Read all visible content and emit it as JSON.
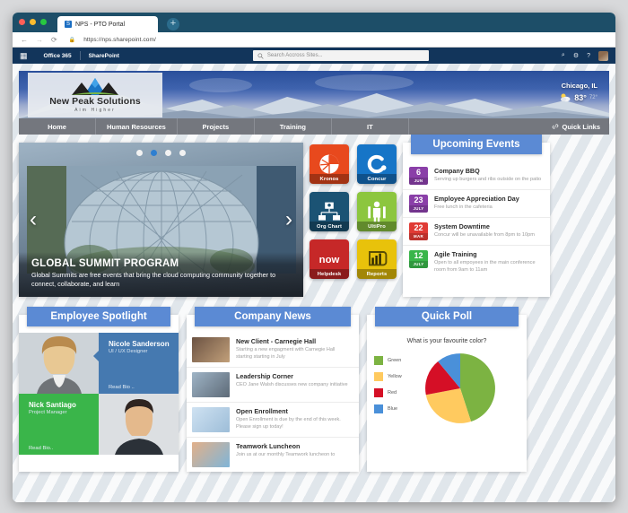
{
  "browser": {
    "tab_title": "NPS - PTO Portal",
    "tab_favicon": "sharepoint-favicon",
    "new_tab_label": "+",
    "back_icon": "←",
    "forward_icon": "→",
    "reload_icon": "⟳",
    "lock_icon": "●",
    "url": "https://nps.sharepoint.com/"
  },
  "suitebar": {
    "waffle_icon": "app-launcher-icon",
    "brand": "Office 365",
    "app": "SharePoint",
    "search_placeholder": "Search Accross Sites...",
    "search_icon": "search-icon",
    "notifications_icon": "⌕",
    "settings_icon": "⚙",
    "help_icon": "?",
    "avatar": "user-avatar"
  },
  "banner": {
    "logo_name": "New Peak Solutions",
    "logo_tagline": "Aim Higher",
    "weather": {
      "city": "Chicago, IL",
      "icon": "partly-cloudy-icon",
      "high": "83°",
      "low": "72°"
    }
  },
  "nav": {
    "items": [
      {
        "label": "Home"
      },
      {
        "label": "Human Resources"
      },
      {
        "label": "Projects"
      },
      {
        "label": "Training"
      },
      {
        "label": "IT"
      }
    ],
    "quick_links": {
      "label": "Quick Links",
      "icon": "link-icon"
    }
  },
  "hero": {
    "title": "GLOBAL SUMMIT PROGRAM",
    "subtitle": "Global Summits are free events that bring the cloud computing community together to connect, collaborate, and learn",
    "prev_icon": "‹",
    "next_icon": "›",
    "dots": 4,
    "active_dot": 1
  },
  "tiles": [
    {
      "label": "Kronos",
      "icon": "kronos-icon",
      "color": "#e8491d"
    },
    {
      "label": "Concur",
      "icon": "concur-icon",
      "color": "#1675c7"
    },
    {
      "label": "Org Chart",
      "icon": "org-chart-icon",
      "color": "#1b5374"
    },
    {
      "label": "UltiPro",
      "icon": "ultipro-icon",
      "color": "#8cc63f"
    },
    {
      "label": "Helpdesk",
      "icon": "servicenow-icon",
      "color": "#c62828"
    },
    {
      "label": "Reports",
      "icon": "power-bi-icon",
      "color": "#e8c20b"
    }
  ],
  "events": {
    "title": "Upcoming Events",
    "items": [
      {
        "day": "6",
        "month": "JUN",
        "color": "#8a3fa8",
        "title": "Company BBQ",
        "desc": "Serving up burgers and ribs outside on the patio"
      },
      {
        "day": "23",
        "month": "JULY",
        "color": "#8a3fa8",
        "title": "Employee Appreciation Day",
        "desc": "Free lunch in the cafeteria"
      },
      {
        "day": "22",
        "month": "MAR",
        "color": "#e03b35",
        "title": "System Downtime",
        "desc": "Concur will be unavailable from 8pm to 10pm"
      },
      {
        "day": "12",
        "month": "JULY",
        "color": "#3ab54a",
        "title": "Agile Training",
        "desc": "Open to all empoyees in the main conference room from 9am to 11am"
      }
    ]
  },
  "spotlight": {
    "title": "Employee Spotlight",
    "people": [
      {
        "name": "Nicole Sanderson",
        "role": "UI / UX Designer",
        "link": "Read Bio ..",
        "accent": "#4579b0"
      },
      {
        "name": "Nick Santiago",
        "role": "Project Manager",
        "link": "Read Bio..",
        "accent": "#3ab54a"
      }
    ]
  },
  "news": {
    "title": "Company News",
    "items": [
      {
        "title": "New Client - Carnegie Hall",
        "desc": "Starting a new engagment with Carnegie Hall starting starting in July",
        "thumb": "carnegie-hall-thumb"
      },
      {
        "title": "Leadership Corner",
        "desc": "CEO Jane Walsh discusses new company initiative",
        "thumb": "leadership-thumb"
      },
      {
        "title": "Open Enrollment",
        "desc": "Open Enrollment is due by the end of this week. Please sign up today!",
        "thumb": "stethoscope-thumb"
      },
      {
        "title": "Teamwork Luncheon",
        "desc": "Join us at our monthly Teamwork luncheon to",
        "thumb": "teamwork-thumb"
      }
    ]
  },
  "poll": {
    "title": "Quick Poll",
    "chart_data": {
      "type": "pie",
      "title": "What is your favourite color?",
      "categories": [
        "Green",
        "Yellow",
        "Red",
        "Blue"
      ],
      "values": [
        45,
        27,
        17,
        11
      ],
      "colors": [
        "#7cb342",
        "#ffca5f",
        "#d50f26",
        "#4a90d9"
      ],
      "legend_position": "left"
    }
  }
}
